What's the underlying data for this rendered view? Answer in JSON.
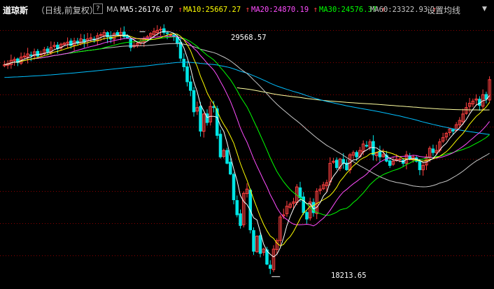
{
  "header": {
    "title": "道琼斯",
    "subtitle": "（日线,前复权）",
    "help_label": "?",
    "ma_label": "MA",
    "settings_label": "设置均线",
    "dropdown_icon": "chevron-down-icon"
  },
  "ma_items": [
    {
      "label": "MA5:26176.07",
      "arrow": "↑",
      "color": "#ffffff"
    },
    {
      "label": "MA10:25667.27",
      "arrow": "↑",
      "color": "#ffff00"
    },
    {
      "label": "MA20:24870.19",
      "arrow": "↑",
      "color": "#ff4dff"
    },
    {
      "label": "MA30:24576.37",
      "arrow": "↑",
      "color": "#00ff00"
    },
    {
      "label": "MA60:23322.93",
      "arrow": "↑",
      "color": "#c8c8c8"
    }
  ],
  "colors": {
    "background": "#000000",
    "grid": "#8b0000",
    "up": "#ff4040",
    "down": "#00e5e5",
    "ma5": "#ffffff",
    "ma10": "#ffff00",
    "ma20": "#ff4dff",
    "ma30": "#00ff00",
    "ma60": "#c8c8c8",
    "ma120": "#00bfff",
    "ma250": "#ffffa0"
  },
  "chart_data": {
    "type": "candlestick",
    "title": "道琼斯",
    "high_label": "29568.57",
    "low_label": "18213.65",
    "ylim": [
      17800,
      30000
    ],
    "y_gridlines": [
      19000,
      20500,
      22000,
      23500,
      25000,
      26500,
      28000,
      29500
    ],
    "x_period": "daily",
    "close_series": [
      27900,
      27950,
      28100,
      28150,
      28000,
      28250,
      28300,
      28400,
      28350,
      28500,
      28300,
      28400,
      28600,
      28500,
      28700,
      28800,
      28650,
      28850,
      28900,
      28950,
      28800,
      29000,
      28900,
      29100,
      28950,
      29100,
      29150,
      29050,
      29250,
      29300,
      29400,
      29200,
      29100,
      29350,
      29300,
      29400,
      29200,
      29150,
      28700,
      28800,
      28900,
      29000,
      29100,
      29200,
      29350,
      29450,
      29500,
      29550,
      29400,
      29350,
      29300,
      29200,
      28900,
      28200,
      27800,
      27100,
      26700,
      25700,
      25900,
      24800,
      25600,
      25200,
      25950,
      25900,
      24600,
      23600,
      23900,
      23300,
      22800,
      21600,
      20900,
      20400,
      21900,
      22100,
      20200,
      19200,
      19900,
      19100,
      19300,
      18600,
      18400,
      19300,
      19700,
      20800,
      20900,
      21300,
      21400,
      21500,
      22200,
      21700,
      21000,
      20700,
      21500,
      21000,
      22000,
      22100,
      22300,
      22400,
      23300,
      23400,
      23100,
      23500,
      23300,
      23000,
      23700,
      23800,
      23600,
      23900,
      24200,
      24100,
      24300,
      23700,
      23800,
      23600,
      23700,
      23400,
      23200,
      23400,
      23500,
      23500,
      23300,
      23700,
      23500,
      23600,
      23400,
      23000,
      23200,
      23600,
      24000,
      23800,
      23900,
      24300,
      24500,
      24700,
      24900,
      24800,
      25100,
      25300,
      25600,
      25900,
      26100,
      26200,
      26300,
      26000,
      26500,
      26300,
      27200
    ]
  }
}
